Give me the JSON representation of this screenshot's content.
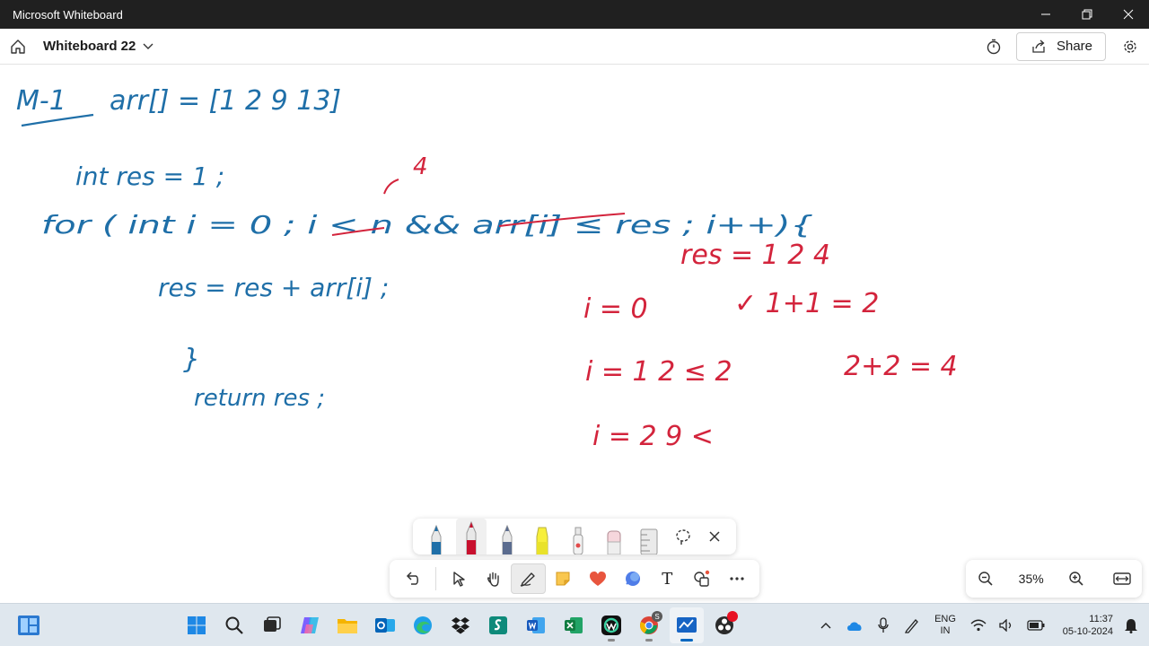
{
  "window": {
    "title": "Microsoft Whiteboard"
  },
  "header": {
    "board_name": "Whiteboard 22",
    "share_label": "Share"
  },
  "zoom": {
    "level": "35%"
  },
  "canvas": {
    "blue_ink": [
      "M-1",
      "arr[] = [1  2  9  13]",
      "int res = 1 ;",
      "for ( int i = 0 ; i < n && arr[i] ≤ res ; i++){",
      "res = res + arr[i] ;",
      "}",
      "return res ;"
    ],
    "red_ink": [
      "4",
      "res = 1  2  4",
      "i = 0",
      "✓  1+1 = 2",
      "i = 1   2 ≤ 2",
      "2+2 = 4",
      "i = 2   9 <"
    ]
  },
  "taskbar": {
    "language_line1": "ENG",
    "language_line2": "IN",
    "time": "11:37",
    "date": "05-10-2024",
    "chrome_badge": "S"
  },
  "colors": {
    "blue_ink": "#1f6fa8",
    "red_ink": "#d3243c",
    "accent": "#0067c0"
  }
}
